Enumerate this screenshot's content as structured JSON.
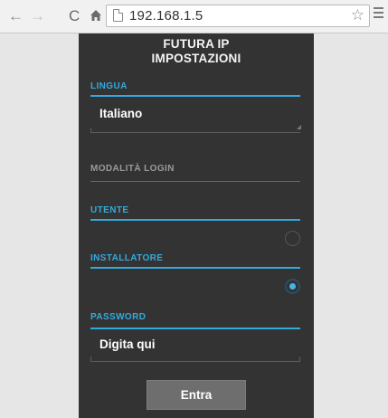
{
  "browser": {
    "back_glyph": "←",
    "forward_glyph": "→",
    "reload_glyph": "C",
    "home_glyph": "⌂",
    "url": "192.168.1.5",
    "star_glyph": "☆"
  },
  "app": {
    "title_line1": "FUTURA IP",
    "title_line2": "IMPOSTAZIONI",
    "language": {
      "label": "LINGUA",
      "value": "Italiano"
    },
    "login_mode": {
      "label": "MODALITÀ LOGIN",
      "options": [
        {
          "label": "UTENTE",
          "selected": false
        },
        {
          "label": "INSTALLATORE",
          "selected": true
        }
      ]
    },
    "password": {
      "label": "PASSWORD",
      "placeholder": "Digita qui"
    },
    "submit_label": "Entra"
  },
  "colors": {
    "accent": "#33aadd",
    "panel_background": "#333333",
    "button_background": "#6e6e6e"
  }
}
